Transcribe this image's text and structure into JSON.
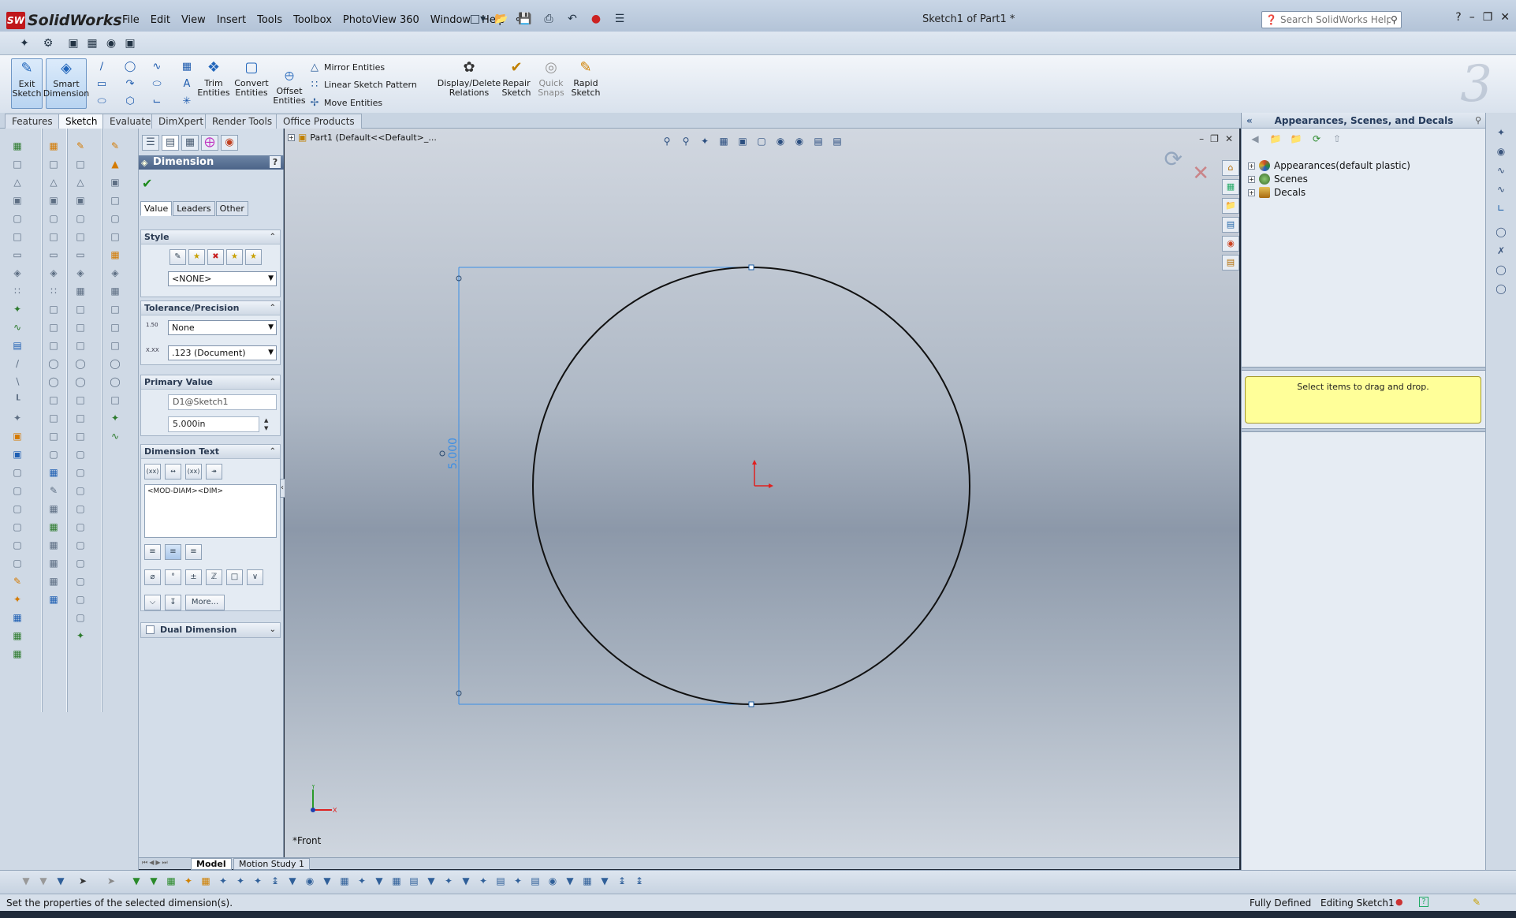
{
  "app": {
    "logo_text": "SolidWorks",
    "logo_badge": "SW",
    "doc_title": "Sketch1 of Part1 *",
    "menu": [
      "File",
      "Edit",
      "View",
      "Insert",
      "Tools",
      "Toolbox",
      "PhotoView 360",
      "Window",
      "Help"
    ],
    "help_search_placeholder": "Search SolidWorks Help"
  },
  "command_manager": {
    "exit_sketch": [
      "Exit",
      "Sketch"
    ],
    "smart_dimension": [
      "Smart",
      "Dimension"
    ],
    "trim_entities": [
      "Trim",
      "Entities"
    ],
    "convert_entities": [
      "Convert",
      "Entities"
    ],
    "offset_entities": [
      "Offset",
      "Entities"
    ],
    "mirror_entities": "Mirror Entities",
    "linear_sketch_pattern": "Linear Sketch Pattern",
    "move_entities": "Move Entities",
    "display_delete_relations": [
      "Display/Delete",
      "Relations"
    ],
    "repair_sketch": [
      "Repair",
      "Sketch"
    ],
    "quick_snaps": [
      "Quick",
      "Snaps"
    ],
    "rapid_sketch": [
      "Rapid",
      "Sketch"
    ]
  },
  "tabs": [
    {
      "label": "Features",
      "active": false
    },
    {
      "label": "Sketch",
      "active": true
    },
    {
      "label": "Evaluate",
      "active": false
    },
    {
      "label": "DimXpert",
      "active": false
    },
    {
      "label": "Render Tools",
      "active": false
    },
    {
      "label": "Office Products",
      "active": false
    }
  ],
  "property_manager": {
    "title": "Dimension",
    "help": "?",
    "subtabs": [
      "Value",
      "Leaders",
      "Other"
    ],
    "style": {
      "heading": "Style",
      "selected": "<NONE>"
    },
    "tolerance": {
      "heading": "Tolerance/Precision",
      "tolerance_type": "None",
      "precision": ".123 (Document)",
      "tol_icon_text": "1.50",
      "prec_icon_text": "X.XX"
    },
    "primary_value": {
      "heading": "Primary Value",
      "name": "D1@Sketch1",
      "value": "5.000in"
    },
    "dimension_text": {
      "heading": "Dimension Text",
      "text": "<MOD-DIAM><DIM>",
      "more_button": "More..."
    },
    "dual_dimension": {
      "heading": "Dual Dimension",
      "checked": false
    }
  },
  "viewport": {
    "tree_label": "Part1  (Default<<Default>_...",
    "view_label": "*Front",
    "dimension_value": "5.000",
    "triad": {
      "x": "X",
      "y": "Y"
    },
    "colors": {
      "circle": "#111111",
      "dimension": "#3a8ee6",
      "origin": "#e02020"
    }
  },
  "model_tabs": [
    {
      "label": "Model",
      "active": true
    },
    {
      "label": "Motion Study 1",
      "active": false
    }
  ],
  "task_pane": {
    "title": "Appearances, Scenes, and Decals",
    "items": [
      {
        "label": "Appearances(default plastic)",
        "color": "#d24a2a"
      },
      {
        "label": "Scenes",
        "color": "#4a8a3a"
      },
      {
        "label": "Decals",
        "color": "#b07a20"
      }
    ],
    "drop_hint": "Select items to drag and drop."
  },
  "status": {
    "message": "Set the properties of the selected dimension(s).",
    "definition": "Fully Defined",
    "editing": "Editing Sketch1"
  }
}
